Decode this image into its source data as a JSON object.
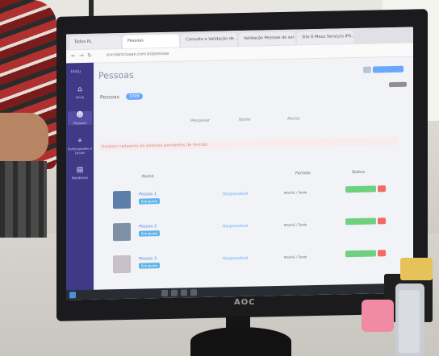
{
  "browser": {
    "tabs": [
      "Todos PL",
      "Pessoas",
      "Consulta e Validação de ...",
      "Validação Pessoas de ser...",
      "Site E-Meus Serviços IPS..."
    ],
    "url": "escolainclusao.com.br/pessoas"
  },
  "sidebar": {
    "logo": "Inclu",
    "items": [
      {
        "label": "Início",
        "icon": "home-icon"
      },
      {
        "label": "Pessoas",
        "icon": "person-icon"
      },
      {
        "label": "Participantes e Locais",
        "icon": "location-icon"
      },
      {
        "label": "Relatórios",
        "icon": "chart-icon"
      }
    ]
  },
  "page": {
    "title": "Pessoas",
    "count_label": "Pessoas",
    "count": "1000",
    "filters": [
      "Pesquisar",
      "Nome",
      "Ativos"
    ],
    "alert": "Existem cadastros de pessoas pendentes de revisão"
  },
  "table": {
    "headers": [
      "Nome",
      "",
      "Período",
      "Status"
    ],
    "rows": [
      {
        "name": "Pessoa 1",
        "tag": "Estudante",
        "link": "Responsável",
        "period": "Manhã / Tarde"
      },
      {
        "name": "Pessoa 2",
        "tag": "Estudante",
        "link": "Responsável",
        "period": "Manhã / Tarde"
      },
      {
        "name": "Pessoa 3",
        "tag": "Estudante",
        "link": "Responsável",
        "period": "Manhã / Tarde"
      }
    ]
  },
  "monitor": {
    "brand": "AOC"
  },
  "colors": {
    "sidebar": "#3e3a86",
    "accent": "#6aa8ff",
    "green": "#6fd07f",
    "red": "#ef6b6b"
  }
}
